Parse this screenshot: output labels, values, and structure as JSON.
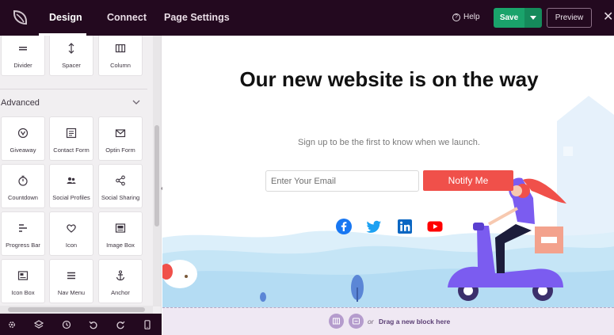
{
  "topbar": {
    "tabs": [
      {
        "label": "Design",
        "active": true
      },
      {
        "label": "Connect",
        "active": false
      },
      {
        "label": "Page Settings",
        "active": false
      }
    ],
    "help_label": "Help",
    "save_label": "Save",
    "preview_label": "Preview",
    "close_icon": "close-icon"
  },
  "sidebar": {
    "top_blocks": [
      {
        "label": "Divider",
        "icon": "divider-icon"
      },
      {
        "label": "Spacer",
        "icon": "spacer-icon"
      },
      {
        "label": "Column",
        "icon": "column-icon"
      }
    ],
    "section": {
      "title": "Advanced",
      "expanded": true
    },
    "advanced_blocks": [
      {
        "label": "Giveaway",
        "icon": "giveaway-icon"
      },
      {
        "label": "Contact Form",
        "icon": "contact-form-icon"
      },
      {
        "label": "Optin Form",
        "icon": "optin-form-icon"
      },
      {
        "label": "Countdown",
        "icon": "stopwatch-icon"
      },
      {
        "label": "Social Profiles",
        "icon": "users-icon"
      },
      {
        "label": "Social Sharing",
        "icon": "share-icon"
      },
      {
        "label": "Progress Bar",
        "icon": "progress-bar-icon"
      },
      {
        "label": "Icon",
        "icon": "heart-icon"
      },
      {
        "label": "Image Box",
        "icon": "image-box-icon"
      },
      {
        "label": "Icon Box",
        "icon": "icon-box-icon"
      },
      {
        "label": "Nav Menu",
        "icon": "menu-icon"
      },
      {
        "label": "Anchor",
        "icon": "anchor-icon"
      }
    ],
    "bottom_toolbar": [
      "settings-icon",
      "layers-icon",
      "history-icon",
      "undo-icon",
      "redo-icon",
      "mobile-preview-icon"
    ]
  },
  "canvas": {
    "headline": "Our new website is on the way",
    "subline": "Sign up to be the first to know when we launch.",
    "email_placeholder": "Enter Your Email",
    "notify_label": "Notify Me",
    "social_icons": [
      "facebook-icon",
      "twitter-icon",
      "linkedin-icon",
      "youtube-icon"
    ]
  },
  "dropzone": {
    "or_label": "or",
    "drag_label": "Drag a new block here"
  },
  "colors": {
    "topbar_bg": "#23091f",
    "save_green": "#1aa36b",
    "notify_red": "#f0504a",
    "dropzone_bg": "#efe8f3",
    "accent_purple": "#7b5cf0"
  }
}
